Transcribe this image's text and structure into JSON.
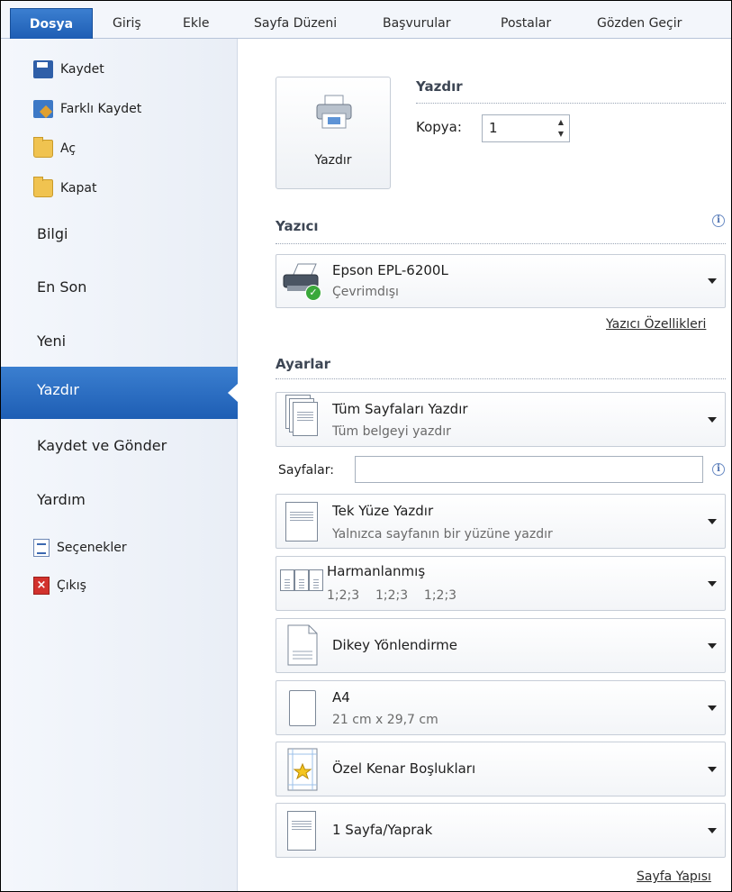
{
  "ribbon": {
    "tabs": [
      "Dosya",
      "Giriş",
      "Ekle",
      "Sayfa Düzeni",
      "Başvurular",
      "Postalar",
      "Gözden Geçir"
    ]
  },
  "nav": {
    "commands": [
      "Kaydet",
      "Farklı Kaydet",
      "Aç",
      "Kapat"
    ],
    "items": [
      "Bilgi",
      "En Son",
      "Yeni",
      "Yazdır",
      "Kaydet ve Gönder",
      "Yardım"
    ],
    "selected": "Yazdır",
    "bottom": [
      "Seçenekler",
      "Çıkış"
    ]
  },
  "print": {
    "section_title": "Yazdır",
    "button_label": "Yazdır",
    "copies_label": "Kopya:",
    "copies_value": "1"
  },
  "printer": {
    "section_title": "Yazıcı",
    "name": "Epson EPL-6200L",
    "status": "Çevrimdışı",
    "properties_link": "Yazıcı Özellikleri"
  },
  "settings": {
    "section_title": "Ayarlar",
    "range": {
      "title": "Tüm Sayfaları Yazdır",
      "subtitle": "Tüm belgeyi yazdır"
    },
    "pages_label": "Sayfalar:",
    "pages_value": "",
    "sides": {
      "title": "Tek Yüze Yazdır",
      "subtitle": "Yalnızca sayfanın bir yüzüne yazdır"
    },
    "collation": {
      "title": "Harmanlanmış",
      "subtitle": "1;2;3    1;2;3    1;2;3"
    },
    "orientation": {
      "title": "Dikey Yönlendirme"
    },
    "paper": {
      "title": "A4",
      "subtitle": "21 cm x 29,7 cm"
    },
    "margins": {
      "title": "Özel Kenar Boşlukları"
    },
    "per_sheet": {
      "title": "1 Sayfa/Yaprak"
    },
    "page_setup_link": "Sayfa Yapısı"
  }
}
